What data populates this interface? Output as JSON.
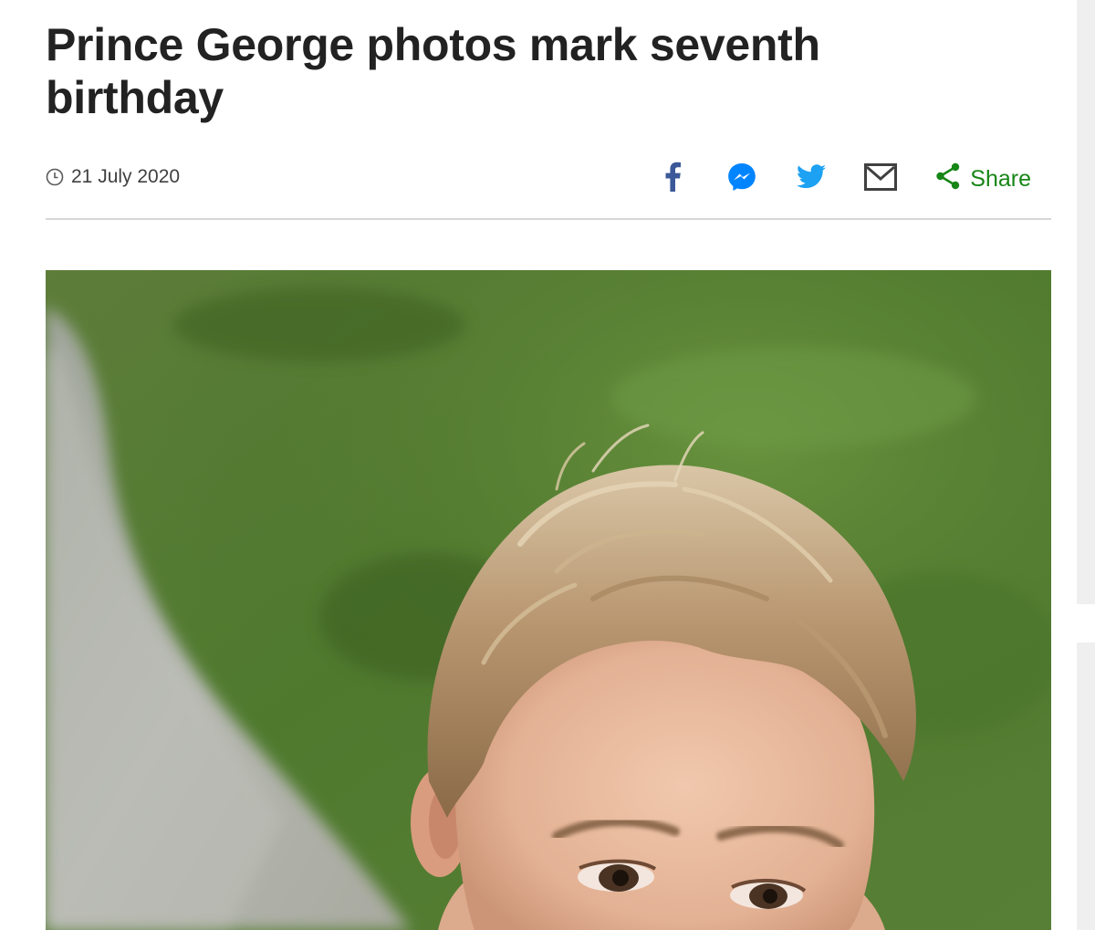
{
  "article": {
    "headline": "Prince George photos mark seventh birthday",
    "date": "21 July 2020"
  },
  "share": {
    "facebook_icon": "facebook-icon",
    "messenger_icon": "messenger-icon",
    "twitter_icon": "twitter-icon",
    "email_icon": "email-icon",
    "share_icon": "share-icon",
    "share_label": "Share"
  },
  "colors": {
    "headline": "#222222",
    "facebook": "#3b5998",
    "messenger": "#0084ff",
    "twitter": "#1da1f2",
    "email": "#404040",
    "share": "#178617",
    "divider": "#d7d7d7"
  }
}
